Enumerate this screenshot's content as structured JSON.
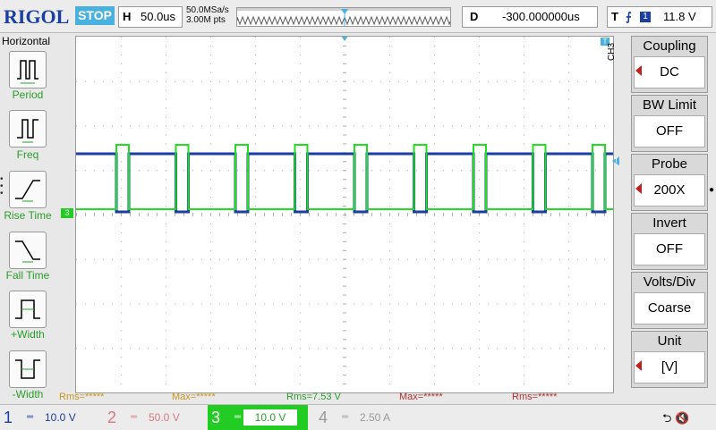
{
  "header": {
    "logo": "RIGOL",
    "run_status": "STOP",
    "timebase_label": "H",
    "timebase_value": "50.0us",
    "sample_rate": "50.0MSa/s",
    "memory_depth": "3.00M pts",
    "delay_label": "D",
    "delay_value": "-300.000000us",
    "trigger_label": "T",
    "trigger_source": "1",
    "trigger_level": "11.8 V"
  },
  "horizontal_menu": {
    "title": "Horizontal",
    "items": [
      {
        "label": "Period",
        "icon": "period-icon"
      },
      {
        "label": "Freq",
        "icon": "freq-icon"
      },
      {
        "label": "Rise Time",
        "icon": "rise-time-icon"
      },
      {
        "label": "Fall Time",
        "icon": "fall-time-icon"
      },
      {
        "label": "+Width",
        "icon": "pos-width-icon"
      },
      {
        "label": "-Width",
        "icon": "neg-width-icon"
      }
    ]
  },
  "measurements": [
    {
      "text": "Rms=*****",
      "color": "#c8961e"
    },
    {
      "text": "Max=*****",
      "color": "#c8961e"
    },
    {
      "text": "Rms=7.53 V",
      "color": "#2a9d2a"
    },
    {
      "text": "Max=*****",
      "color": "#b03030"
    },
    {
      "text": "Rms=*****",
      "color": "#b03030"
    }
  ],
  "channel_menu": {
    "channel_tag": "CH3",
    "groups": [
      {
        "title": "Coupling",
        "value": "DC",
        "has_arrow": true
      },
      {
        "title": "BW Limit",
        "value": "OFF",
        "has_arrow": false
      },
      {
        "title": "Probe",
        "value": "200X",
        "has_arrow": true
      },
      {
        "title": "Invert",
        "value": "OFF",
        "has_arrow": false
      },
      {
        "title": "Volts/Div",
        "value": "Coarse",
        "has_arrow": false
      },
      {
        "title": "Unit",
        "value": "[V]",
        "has_arrow": true
      }
    ]
  },
  "channels": [
    {
      "num": "1",
      "scale": "10.0 V",
      "color": "#1a3fa0"
    },
    {
      "num": "2",
      "scale": "50.0 V",
      "color": "#d87a7a"
    },
    {
      "num": "3",
      "scale": "10.0 V",
      "color": "#22cc22"
    },
    {
      "num": "4",
      "scale": "2.50 A",
      "color": "#999999"
    }
  ],
  "markers": {
    "ch1": "1",
    "ch3": "3",
    "trigger": "T"
  },
  "colors": {
    "ch1": "#1a3fa0",
    "ch3": "#22dd22",
    "grid_dot": "#b0b0b0",
    "accent": "#4ab0de"
  }
}
